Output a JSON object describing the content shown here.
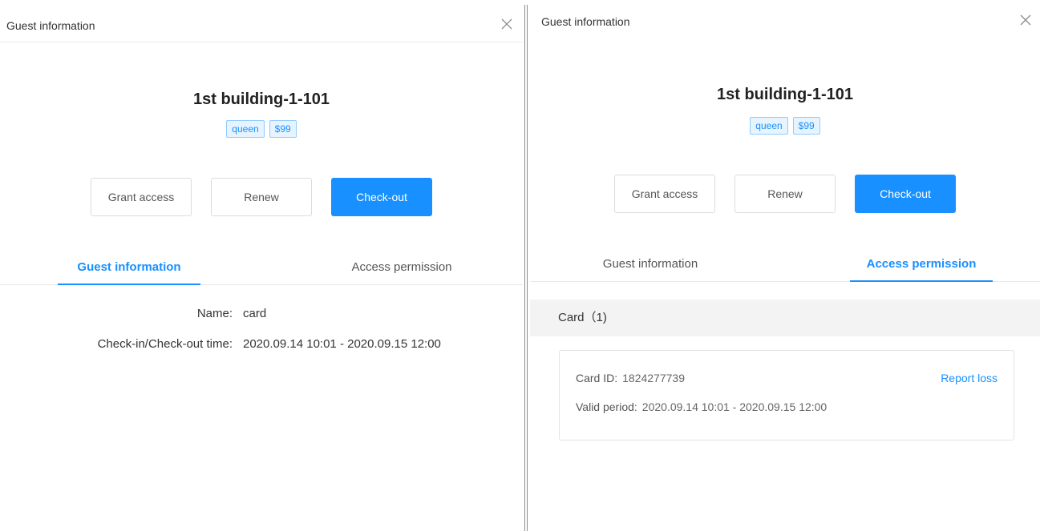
{
  "left_panel": {
    "header_title": "Guest information",
    "room_title": "1st building-1-101",
    "tags": [
      "queen",
      "$99"
    ],
    "buttons": {
      "grant_access": "Grant access",
      "renew": "Renew",
      "checkout": "Check-out"
    },
    "tabs": [
      {
        "label": "Guest information",
        "active": true
      },
      {
        "label": "Access permission",
        "active": false
      }
    ],
    "guest_info": {
      "name_label": "Name:",
      "name_value": "card",
      "time_label": "Check-in/Check-out time:",
      "time_value": "2020.09.14 10:01 - 2020.09.15 12:00"
    }
  },
  "right_panel": {
    "header_title": "Guest information",
    "room_title": "1st building-1-101",
    "tags": [
      "queen",
      "$99"
    ],
    "buttons": {
      "grant_access": "Grant access",
      "renew": "Renew",
      "checkout": "Check-out"
    },
    "tabs": [
      {
        "label": "Guest information",
        "active": false
      },
      {
        "label": "Access permission",
        "active": true
      }
    ],
    "card_section": {
      "header": "Card（1)",
      "card_id_label": "Card ID:",
      "card_id_value": "1824277739",
      "valid_label": "Valid period:",
      "valid_value": "2020.09.14 10:01 - 2020.09.15 12:00",
      "report_loss": "Report loss"
    }
  },
  "colors": {
    "accent": "#1890ff",
    "tag_bg": "#e6f4ff",
    "tag_border": "#91caff",
    "section_bg": "#f3f3f3"
  },
  "icons": {
    "close": "close-icon"
  }
}
